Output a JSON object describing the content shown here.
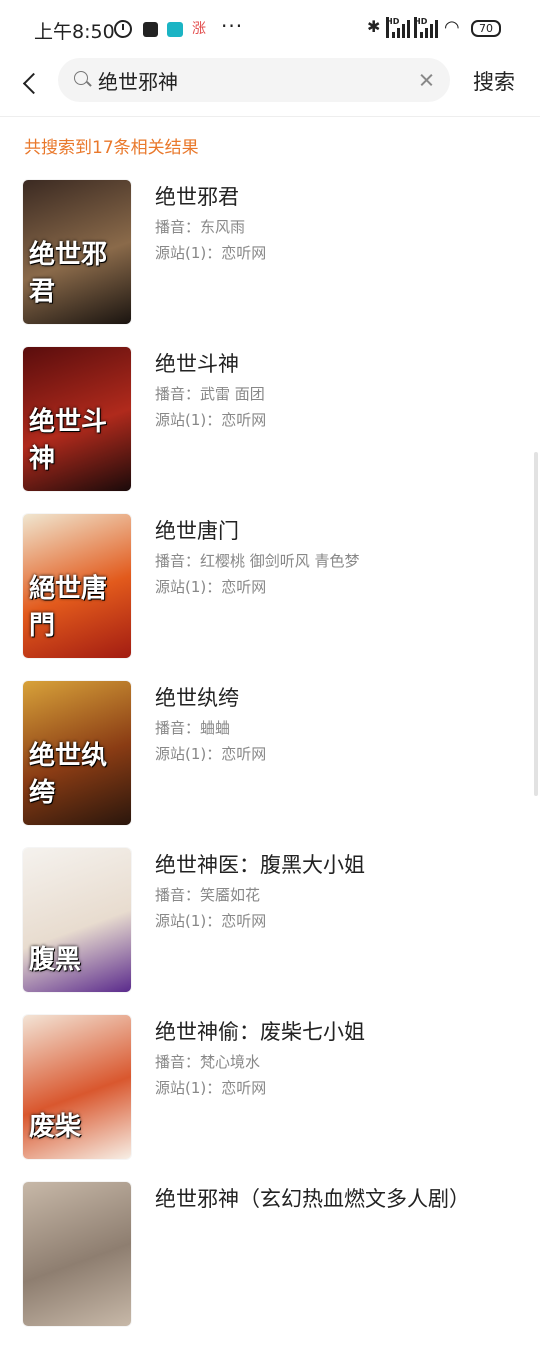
{
  "status": {
    "time": "上午8:50",
    "notif_app_badge": "涨",
    "more": "···",
    "battery": "70"
  },
  "search": {
    "query": "绝世邪神",
    "button": "搜索"
  },
  "result_count": "共搜索到17条相关结果",
  "results": [
    {
      "title": "绝世邪君",
      "narrator": "播音：东风雨",
      "source": "源站(1)：恋听网",
      "cover_text": "绝世邪君",
      "cover_colors": [
        "#3b2a22",
        "#8a6a4a",
        "#1a1410"
      ]
    },
    {
      "title": "绝世斗神",
      "narrator": "播音：武雷   面团",
      "source": "源站(1)：恋听网",
      "cover_text": "绝世斗神",
      "cover_colors": [
        "#5a0d0d",
        "#b02a1c",
        "#1a0a0a"
      ]
    },
    {
      "title": "绝世唐门",
      "narrator": "播音：红樱桃   御剑听风   青色梦",
      "source": "源站(1)：恋听网",
      "cover_text": "絕世唐門",
      "cover_colors": [
        "#f0e6d0",
        "#e25a1c",
        "#a21c12"
      ]
    },
    {
      "title": "绝世纨绔",
      "narrator": "播音：蛐蛐",
      "source": "源站(1)：恋听网",
      "cover_text": "绝世纨绔",
      "cover_colors": [
        "#d8a23a",
        "#8a3c14",
        "#2a160c"
      ]
    },
    {
      "title": "绝世神医：腹黑大小姐",
      "narrator": "播音：笑靥如花",
      "source": "源站(1)：恋听网",
      "cover_text": "腹黑",
      "cover_colors": [
        "#f5f2ee",
        "#e8dccf",
        "#5a2a8c"
      ]
    },
    {
      "title": "绝世神偷：废柴七小姐",
      "narrator": "播音：梵心境水",
      "source": "源站(1)：恋听网",
      "cover_text": "废柴",
      "cover_colors": [
        "#f3e4d6",
        "#d9572e",
        "#f7efe6"
      ]
    },
    {
      "title": "绝世邪神（玄幻热血燃文多人剧）",
      "narrator": "",
      "source": "",
      "cover_text": "",
      "cover_colors": [
        "#c7b8a8",
        "#8e7e70",
        "#c7b8a8"
      ]
    }
  ]
}
